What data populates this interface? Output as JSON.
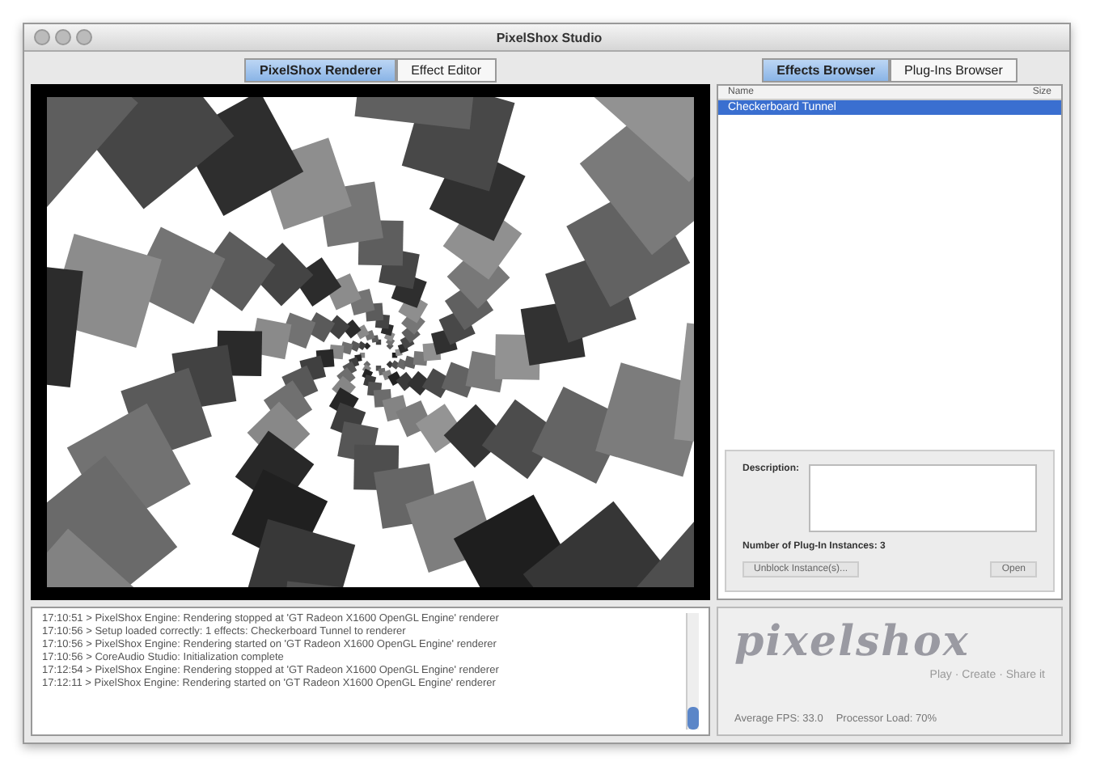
{
  "window": {
    "title": "PixelShox Studio"
  },
  "left_tabs": [
    {
      "label": "PixelShox Renderer",
      "selected": true
    },
    {
      "label": "Effect Editor",
      "selected": false
    }
  ],
  "right_tabs": [
    {
      "label": "Effects Browser",
      "selected": true
    },
    {
      "label": "Plug-Ins Browser",
      "selected": false
    }
  ],
  "effects_table": {
    "columns": [
      "Name",
      "Size"
    ],
    "rows": [
      {
        "cells": [
          "Checkerboard Tunnel",
          ""
        ],
        "selected": true
      }
    ]
  },
  "details": {
    "description_label": "Description:",
    "instances_label": "Number of Plug-In Instances:",
    "instances_value": "3",
    "buttons": [
      "Unblock Instance(s)...",
      "Open"
    ]
  },
  "log": [
    "17:10:51 > PixelShox Engine: Rendering stopped at 'GT Radeon X1600 OpenGL Engine' renderer",
    "17:10:56 > Setup loaded correctly: 1 effects: Checkerboard Tunnel to renderer",
    "17:10:56 > PixelShox Engine: Rendering started on 'GT Radeon X1600 OpenGL Engine' renderer",
    "17:10:56 > CoreAudio Studio: Initialization complete",
    "17:12:54 > PixelShox Engine: Rendering stopped at 'GT Radeon X1600 OpenGL Engine' renderer",
    "17:12:11 > PixelShox Engine: Rendering started on 'GT Radeon X1600 OpenGL Engine' renderer"
  ],
  "logo": {
    "name": "pixelshox",
    "tagline": "Play · Create · Share it"
  },
  "status": [
    {
      "label": "Average FPS:",
      "value": "33.0"
    },
    {
      "label": "Processor Load:",
      "value": "70%"
    }
  ]
}
